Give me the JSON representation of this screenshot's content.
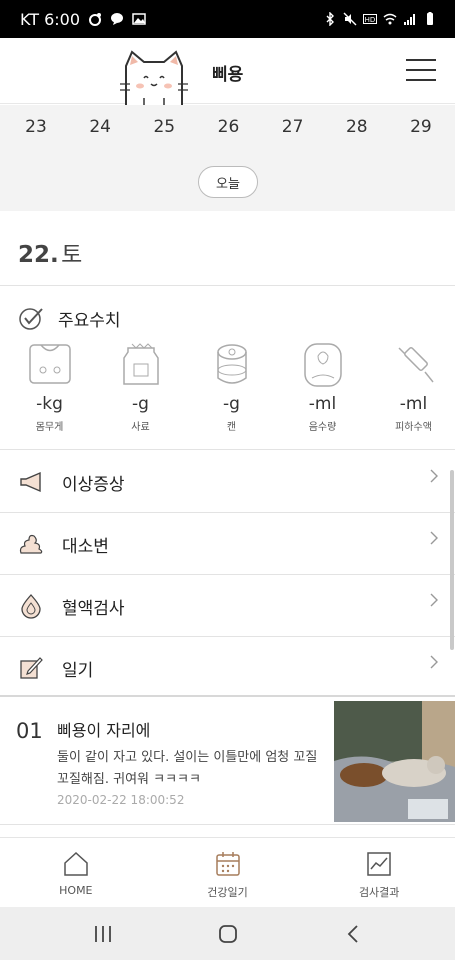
{
  "status_bar": {
    "carrier_time": "KT 6:00"
  },
  "header": {
    "pet_name": "삐용"
  },
  "calendar": {
    "days": [
      "23",
      "24",
      "25",
      "26",
      "27",
      "28",
      "29"
    ],
    "today_label": "오늘"
  },
  "selected_date": {
    "day": "22",
    "dot": ".",
    "weekday": "토"
  },
  "metrics": {
    "title": "주요수치",
    "items": [
      {
        "value": "-kg",
        "label": "몸무게",
        "icon": "scale-icon"
      },
      {
        "value": "-g",
        "label": "사료",
        "icon": "food-bag-icon"
      },
      {
        "value": "-g",
        "label": "캔",
        "icon": "can-icon"
      },
      {
        "value": "-ml",
        "label": "음수량",
        "icon": "water-bowl-icon"
      },
      {
        "value": "-ml",
        "label": "피하수액",
        "icon": "syringe-icon"
      }
    ]
  },
  "sections": {
    "symptoms": "이상증상",
    "stool": "대소변",
    "blood_test": "혈액검사",
    "diary": "일기"
  },
  "diary_entry": {
    "number": "01",
    "title": "삐용이 자리에",
    "body": "둘이 같이 자고 있다. 설이는 이틀만에 엄청 꼬질꼬질해짐. 귀여워 ㅋㅋㅋㅋ",
    "datetime": "2020-02-22 18:00:52"
  },
  "tabs": {
    "home": "HOME",
    "health_diary": "건강일기",
    "test_results": "검사결과"
  },
  "colors": {
    "accent": "#d9a98f",
    "icon_gray": "#aaaaaa",
    "background_strip": "#f3f3f3"
  }
}
